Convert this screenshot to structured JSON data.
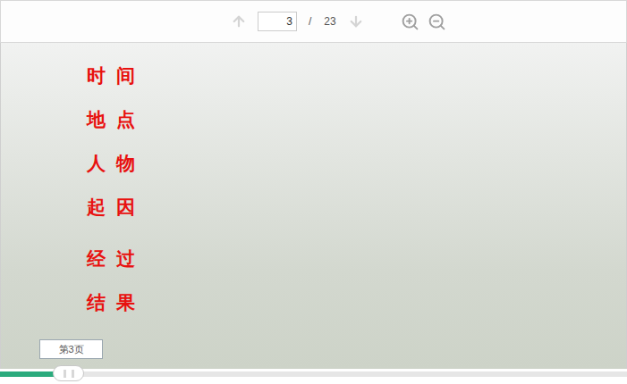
{
  "toolbar": {
    "page": "3",
    "separator": "/",
    "total": "23",
    "prev_disabled": true,
    "next_disabled": true
  },
  "slide": {
    "label_groups": [
      [
        "时间",
        "地点",
        "人物",
        "起因"
      ],
      [
        "经过",
        "结果"
      ]
    ],
    "label_color": "#e8110f"
  },
  "progress": {
    "level": 0.09,
    "tooltip": "第3页"
  }
}
